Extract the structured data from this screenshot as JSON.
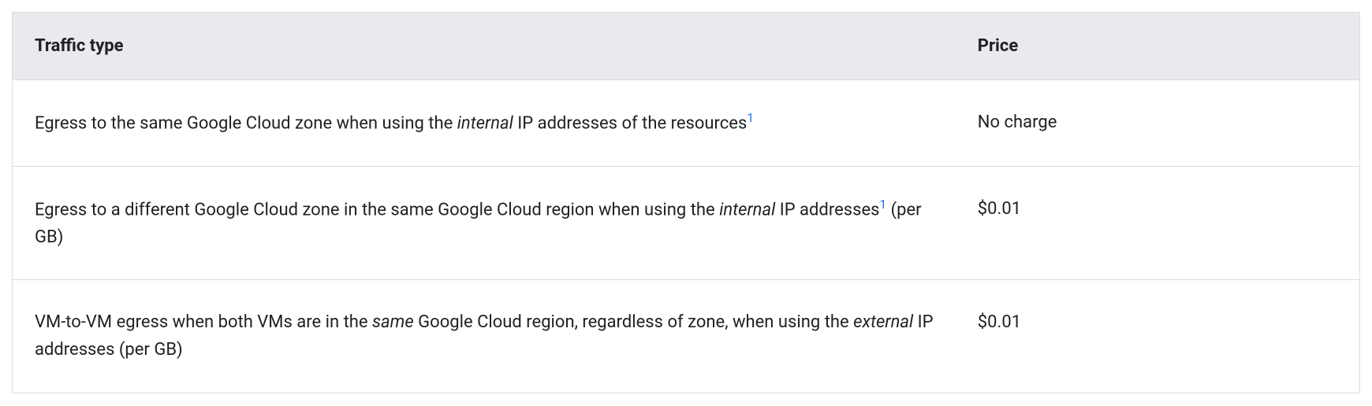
{
  "chart_data": {
    "type": "table",
    "headers": {
      "traffic_type": "Traffic type",
      "price": "Price"
    },
    "rows": [
      {
        "traffic_pre": "Egress to the same Google Cloud zone when using the ",
        "traffic_italic": "internal",
        "traffic_post": " IP addresses of the resources",
        "footnote": "1",
        "traffic_tail": "",
        "price": "No charge"
      },
      {
        "traffic_pre": "Egress to a different Google Cloud zone in the same Google Cloud region when using the ",
        "traffic_italic": "internal",
        "traffic_post": " IP addresses",
        "footnote": "1",
        "traffic_tail": " (per GB)",
        "price": "$0.01"
      },
      {
        "traffic_pre": "VM-to-VM egress when both VMs are in the ",
        "traffic_italic": "same",
        "traffic_post": " Google Cloud region, regardless of zone, when using the ",
        "traffic_italic2": "external",
        "traffic_post2": " IP addresses (per GB)",
        "price": "$0.01"
      }
    ]
  }
}
